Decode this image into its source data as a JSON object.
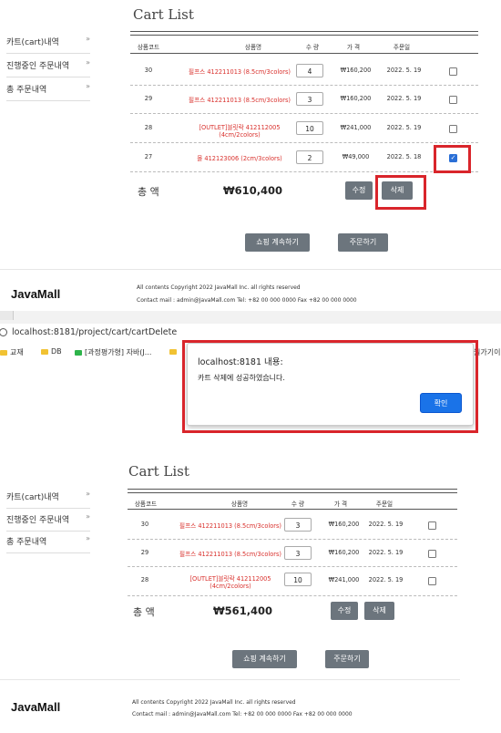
{
  "sidebar": {
    "items": [
      {
        "label": "카트(cart)내역",
        "arrow": "»"
      },
      {
        "label": "진행중인 주문내역",
        "arrow": "»"
      },
      {
        "label": "총 주문내역",
        "arrow": "»"
      }
    ]
  },
  "cart_title": "Cart List",
  "headers": [
    "상품코드",
    "상품명",
    "수 량",
    "가 격",
    "주문일"
  ],
  "before": {
    "rows": [
      {
        "code": "30",
        "name": "필프스 412211013 (8.5cm/3colors)",
        "name2": "",
        "qty": "4",
        "price": "₩160,200",
        "date": "2022. 5. 19",
        "checked": false
      },
      {
        "code": "29",
        "name": "필프스 412211013 (8.5cm/3colors)",
        "name2": "",
        "qty": "3",
        "price": "₩160,200",
        "date": "2022. 5. 19",
        "checked": false
      },
      {
        "code": "28",
        "name": "[OUTLET]블릿락 412112005",
        "name2": "(4cm/2colors)",
        "qty": "10",
        "price": "₩241,000",
        "date": "2022. 5. 19",
        "checked": false
      },
      {
        "code": "27",
        "name": "몰 412123006 (2cm/3colors)",
        "name2": "",
        "qty": "2",
        "price": "₩49,000",
        "date": "2022. 5. 18",
        "checked": true
      }
    ],
    "total_label": "총 액",
    "total_value": "₩610,400"
  },
  "after": {
    "rows": [
      {
        "code": "30",
        "name": "필프스 412211013 (8.5cm/3colors)",
        "name2": "",
        "qty": "3",
        "price": "₩160,200",
        "date": "2022. 5. 19",
        "checked": false
      },
      {
        "code": "29",
        "name": "필프스 412211013 (8.5cm/3colors)",
        "name2": "",
        "qty": "3",
        "price": "₩160,200",
        "date": "2022. 5. 19",
        "checked": false
      },
      {
        "code": "28",
        "name": "[OUTLET]블릿락 412112005",
        "name2": "(4cm/2colors)",
        "qty": "10",
        "price": "₩241,000",
        "date": "2022. 5. 19",
        "checked": false
      }
    ],
    "total_label": "총 액",
    "total_value": "₩561,400"
  },
  "buttons": {
    "edit": "수정",
    "delete": "삭제",
    "continue_shopping": "쇼핑 계속하기",
    "order": "주문하기"
  },
  "footer": {
    "logo": "JavaMall",
    "copyright": "All contents Copyright 2022 JavaMall Inc. all rights reserved",
    "contact": "Contact mail : admin@JavaMall.com Tel: +82 00 000 0000 Fax +82 00 000 0000"
  },
  "browser": {
    "url": "localhost:8181/project/cart/cartDelete",
    "bookmarks": [
      "교재",
      "DB",
      "[과정평가형] 자바(J...",
      "",
      "월가기이"
    ]
  },
  "alert": {
    "title": "localhost:8181 내용:",
    "message": "카트 삭제에 성공하였습니다.",
    "ok": "확인"
  },
  "colors": {
    "accent_red": "#d9252b",
    "button_gray": "#6c757d",
    "product_red": "#d9302c",
    "checkbox_blue": "#2a6fd6"
  }
}
